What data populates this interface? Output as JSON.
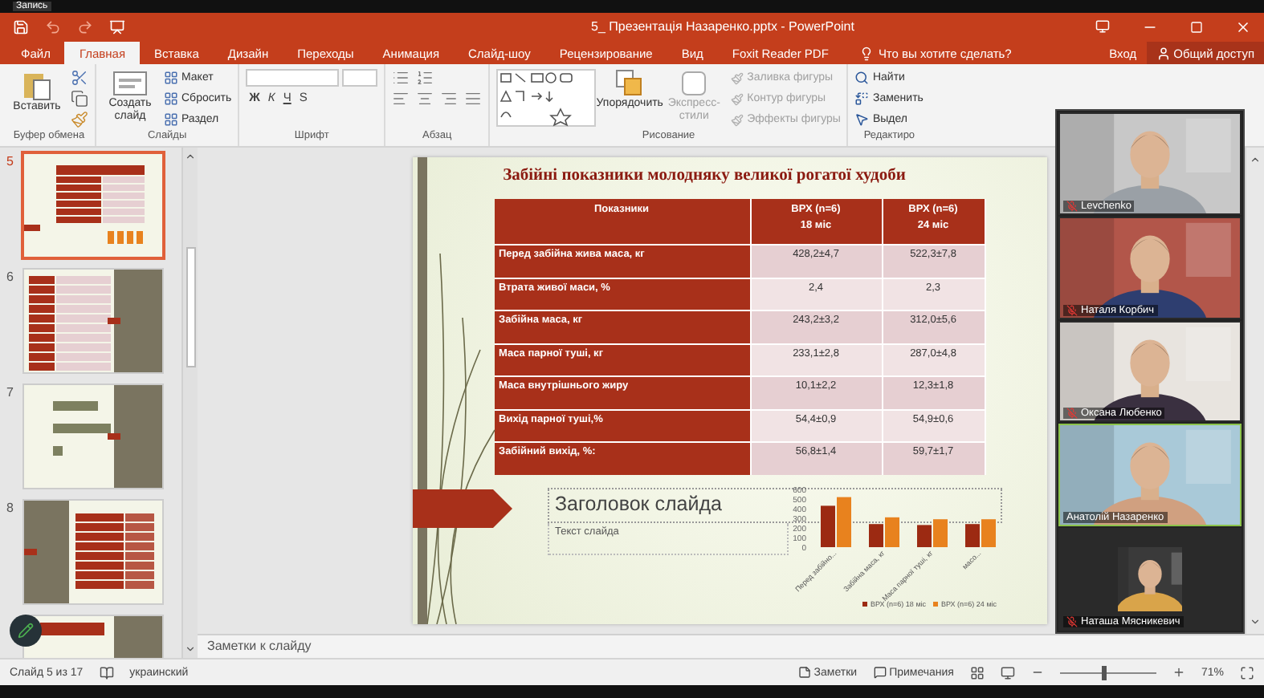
{
  "recording": {
    "label": "Запись"
  },
  "window": {
    "title": "5_ Презентація Назаренко.pptx - PowerPoint"
  },
  "tabs": [
    {
      "label": "Файл",
      "selected": false
    },
    {
      "label": "Главная",
      "selected": true
    },
    {
      "label": "Вставка",
      "selected": false
    },
    {
      "label": "Дизайн",
      "selected": false
    },
    {
      "label": "Переходы",
      "selected": false
    },
    {
      "label": "Анимация",
      "selected": false
    },
    {
      "label": "Слайд-шоу",
      "selected": false
    },
    {
      "label": "Рецензирование",
      "selected": false
    },
    {
      "label": "Вид",
      "selected": false
    },
    {
      "label": "Foxit Reader PDF",
      "selected": false
    }
  ],
  "tell_me": {
    "placeholder": "Что вы хотите сделать?"
  },
  "account": {
    "sign_in": "Вход",
    "share": "Общий доступ"
  },
  "ribbon": [
    {
      "kind": "clipboard",
      "label": "Буфер обмена",
      "button": "Вставить"
    },
    {
      "kind": "slides",
      "label": "Слайды",
      "button": "Создать слайд",
      "items": [
        "Макет",
        "Сбросить",
        "Раздел"
      ]
    },
    {
      "kind": "font",
      "label": "Шрифт",
      "styles": [
        "Ж",
        "К",
        "Ч",
        "S"
      ]
    },
    {
      "kind": "paragraph",
      "label": "Абзац"
    },
    {
      "kind": "drawing",
      "label": "Рисование",
      "button": "Упорядочить",
      "styles_button": {
        "label": "Экспресс-стили",
        "disabled": true
      },
      "items": [
        {
          "label": "Заливка фигуры",
          "disabled": true
        },
        {
          "label": "Контур фигуры",
          "disabled": true
        },
        {
          "label": "Эффекты фигуры",
          "disabled": true
        }
      ]
    },
    {
      "kind": "editing",
      "label": "Редактиро",
      "items": [
        "Найти",
        "Заменить",
        "Выдел"
      ]
    }
  ],
  "thumbnails": [
    {
      "number": "5",
      "selected": true,
      "kind": "table"
    },
    {
      "number": "6",
      "selected": false,
      "kind": "table_side"
    },
    {
      "number": "7",
      "selected": false,
      "kind": "chart_side"
    },
    {
      "number": "8",
      "selected": false,
      "kind": "side_table"
    },
    {
      "selected": false,
      "kind": "partial"
    }
  ],
  "slide": {
    "title": "Забійні показники молодняку великої рогатої худоби",
    "columns": [
      "Показники",
      "ВРХ (n=6)\n18 міс",
      "ВРХ (n=6)\n24 міс"
    ],
    "rows": [
      [
        "Перед забійна жива маса, кг",
        "428,2±4,7",
        "522,3±7,8"
      ],
      [
        "Втрата живої маси, %",
        "2,4",
        "2,3"
      ],
      [
        "Забійна маса, кг",
        "243,2±3,2",
        "312,0±5,6"
      ],
      [
        "Маса парної туші, кг",
        "233,1±2,8",
        "287,0±4,8"
      ],
      [
        "Маса внутрішнього жиру",
        "10,1±2,2",
        "12,3±1,8"
      ],
      [
        "Вихід парної туші,%",
        "54,4±0,9",
        "54,9±0,6"
      ],
      [
        "Забійний вихід, %:",
        "56,8±1,4",
        "59,7±1,7"
      ]
    ],
    "title_placeholder": "Заголовок слайда",
    "text_placeholder": "Текст слайда",
    "chart_data": {
      "type": "bar",
      "categories": [
        "Перед забійно...",
        "Забійна маса, кг",
        "Маса парної туші, кг",
        "масо..."
      ],
      "series": [
        {
          "name": "ВРХ (n=6) 18 міс",
          "color": "#9c2a12",
          "values": [
            430,
            240,
            230,
            240
          ]
        },
        {
          "name": "ВРХ (n=6) 24 міс",
          "color": "#e8821e",
          "values": [
            520,
            310,
            290,
            290
          ]
        }
      ],
      "legend": "bottom",
      "ylim": [
        0,
        600
      ],
      "yticks": [
        0,
        100,
        200,
        300,
        400,
        500,
        600
      ]
    }
  },
  "notes_placeholder": "Заметки к слайду",
  "participants": [
    {
      "name": "Levchenko",
      "muted": true,
      "highlighted": false,
      "kind": "video"
    },
    {
      "name": "Наталя Корбич",
      "muted": true,
      "highlighted": false,
      "kind": "video"
    },
    {
      "name": "Оксана Любенко",
      "muted": true,
      "highlighted": false,
      "kind": "video"
    },
    {
      "name": "Анатолій Назаренко",
      "muted": false,
      "highlighted": true,
      "kind": "video"
    },
    {
      "name": "Наташа Мясникевич",
      "muted": true,
      "highlighted": false,
      "kind": "small"
    }
  ],
  "status_bar": {
    "slide": "Слайд 5 из 17",
    "language": "украинский",
    "notes": "Заметки",
    "comments": "Примечания",
    "zoom": "71%",
    "zoom_slider": {
      "level": 0.45
    }
  }
}
